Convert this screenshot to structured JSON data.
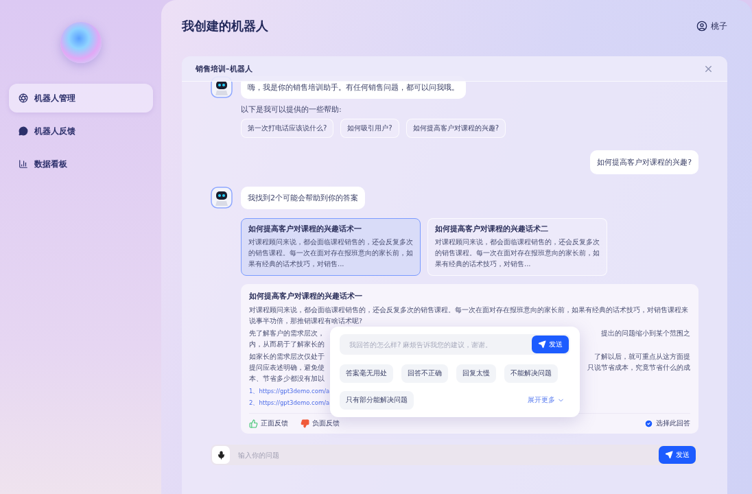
{
  "sidebar": {
    "items": [
      {
        "label": "机器人管理",
        "kind": "robot",
        "selected": true
      },
      {
        "label": "机器人反馈",
        "kind": "feedback",
        "selected": false
      },
      {
        "label": "数据看板",
        "kind": "chart",
        "selected": false
      }
    ]
  },
  "header": {
    "title": "我创建的机器人",
    "user": "桃子"
  },
  "chat": {
    "title": "销售培训–机器人",
    "greeting": "嗨，我是你的销售培训助手。有任何销售问题，都可以问我哦。",
    "help_intro": "以下是我可以提供的一些帮助:",
    "suggestions": [
      "第一次打电话应该说什么?",
      "如何吸引用户?",
      "如何提高客户对课程的兴趣?"
    ],
    "user_question": "如何提高客户对课程的兴趣?",
    "bot_reply": "我找到2个可能会帮助到你的答案",
    "answer_options": [
      {
        "title": "如何提高客户对课程的兴趣话术一",
        "snippet": "对课程顾问来说，都会面临课程销售的，还会反复多次的销售课程。每一次在面对存在报班意向的家长前，如果有经典的话术技巧，对销售...",
        "selected": true
      },
      {
        "title": "如何提高客户对课程的兴趣话术二",
        "snippet": "对课程顾问来说，都会面临课程销售的，还会反复多次的销售课程。每一次在面对存在报班意向的家长前，如果有经典的话术技巧，对销售...",
        "selected": false
      }
    ],
    "answer": {
      "title": "如何提高客户对课程的兴趣话术一",
      "intro": "对课程顾问来说，都会面临课程销售的，还会反复多次的销售课程。每一次在面对存在报班意向的家长前，如果有经典的话术技巧，对销售课程来说事半功倍，那推销课程有啥话术呢?",
      "lines": [
        {
          "left": "先了解客户的需求层次，",
          "right": "提出的问题缩小到某个范围之"
        },
        {
          "left": "内，从而易于了解家长的"
        },
        {
          "left": "如家长的需求层次仅处于",
          "right": "了解以后，就可重点从这方面提"
        },
        {
          "left": "提问应表述明确，避免使",
          "right": "只说节省成本，究竟节省什么的成"
        },
        {
          "left": "本、节省多少都没有加以"
        }
      ],
      "links": [
        "1、https://gpt3demo.com/a",
        "2、https://gpt3demo.com/a"
      ],
      "positive": "正面反馈",
      "negative": "负面反馈",
      "choose": {
        "label": "选择此回答",
        "checked": true
      }
    },
    "feedback_popup": {
      "placeholder": "我回答的怎么样? 麻烦告诉我您的建议，谢谢。",
      "send": "发送",
      "tags": [
        "答案毫无用处",
        "回答不正确",
        "回复太慢",
        "不能解决问题",
        "只有部分能解决问题"
      ],
      "expand": "展开更多"
    },
    "input": {
      "placeholder": "输入你的问题",
      "send": "发送"
    }
  }
}
